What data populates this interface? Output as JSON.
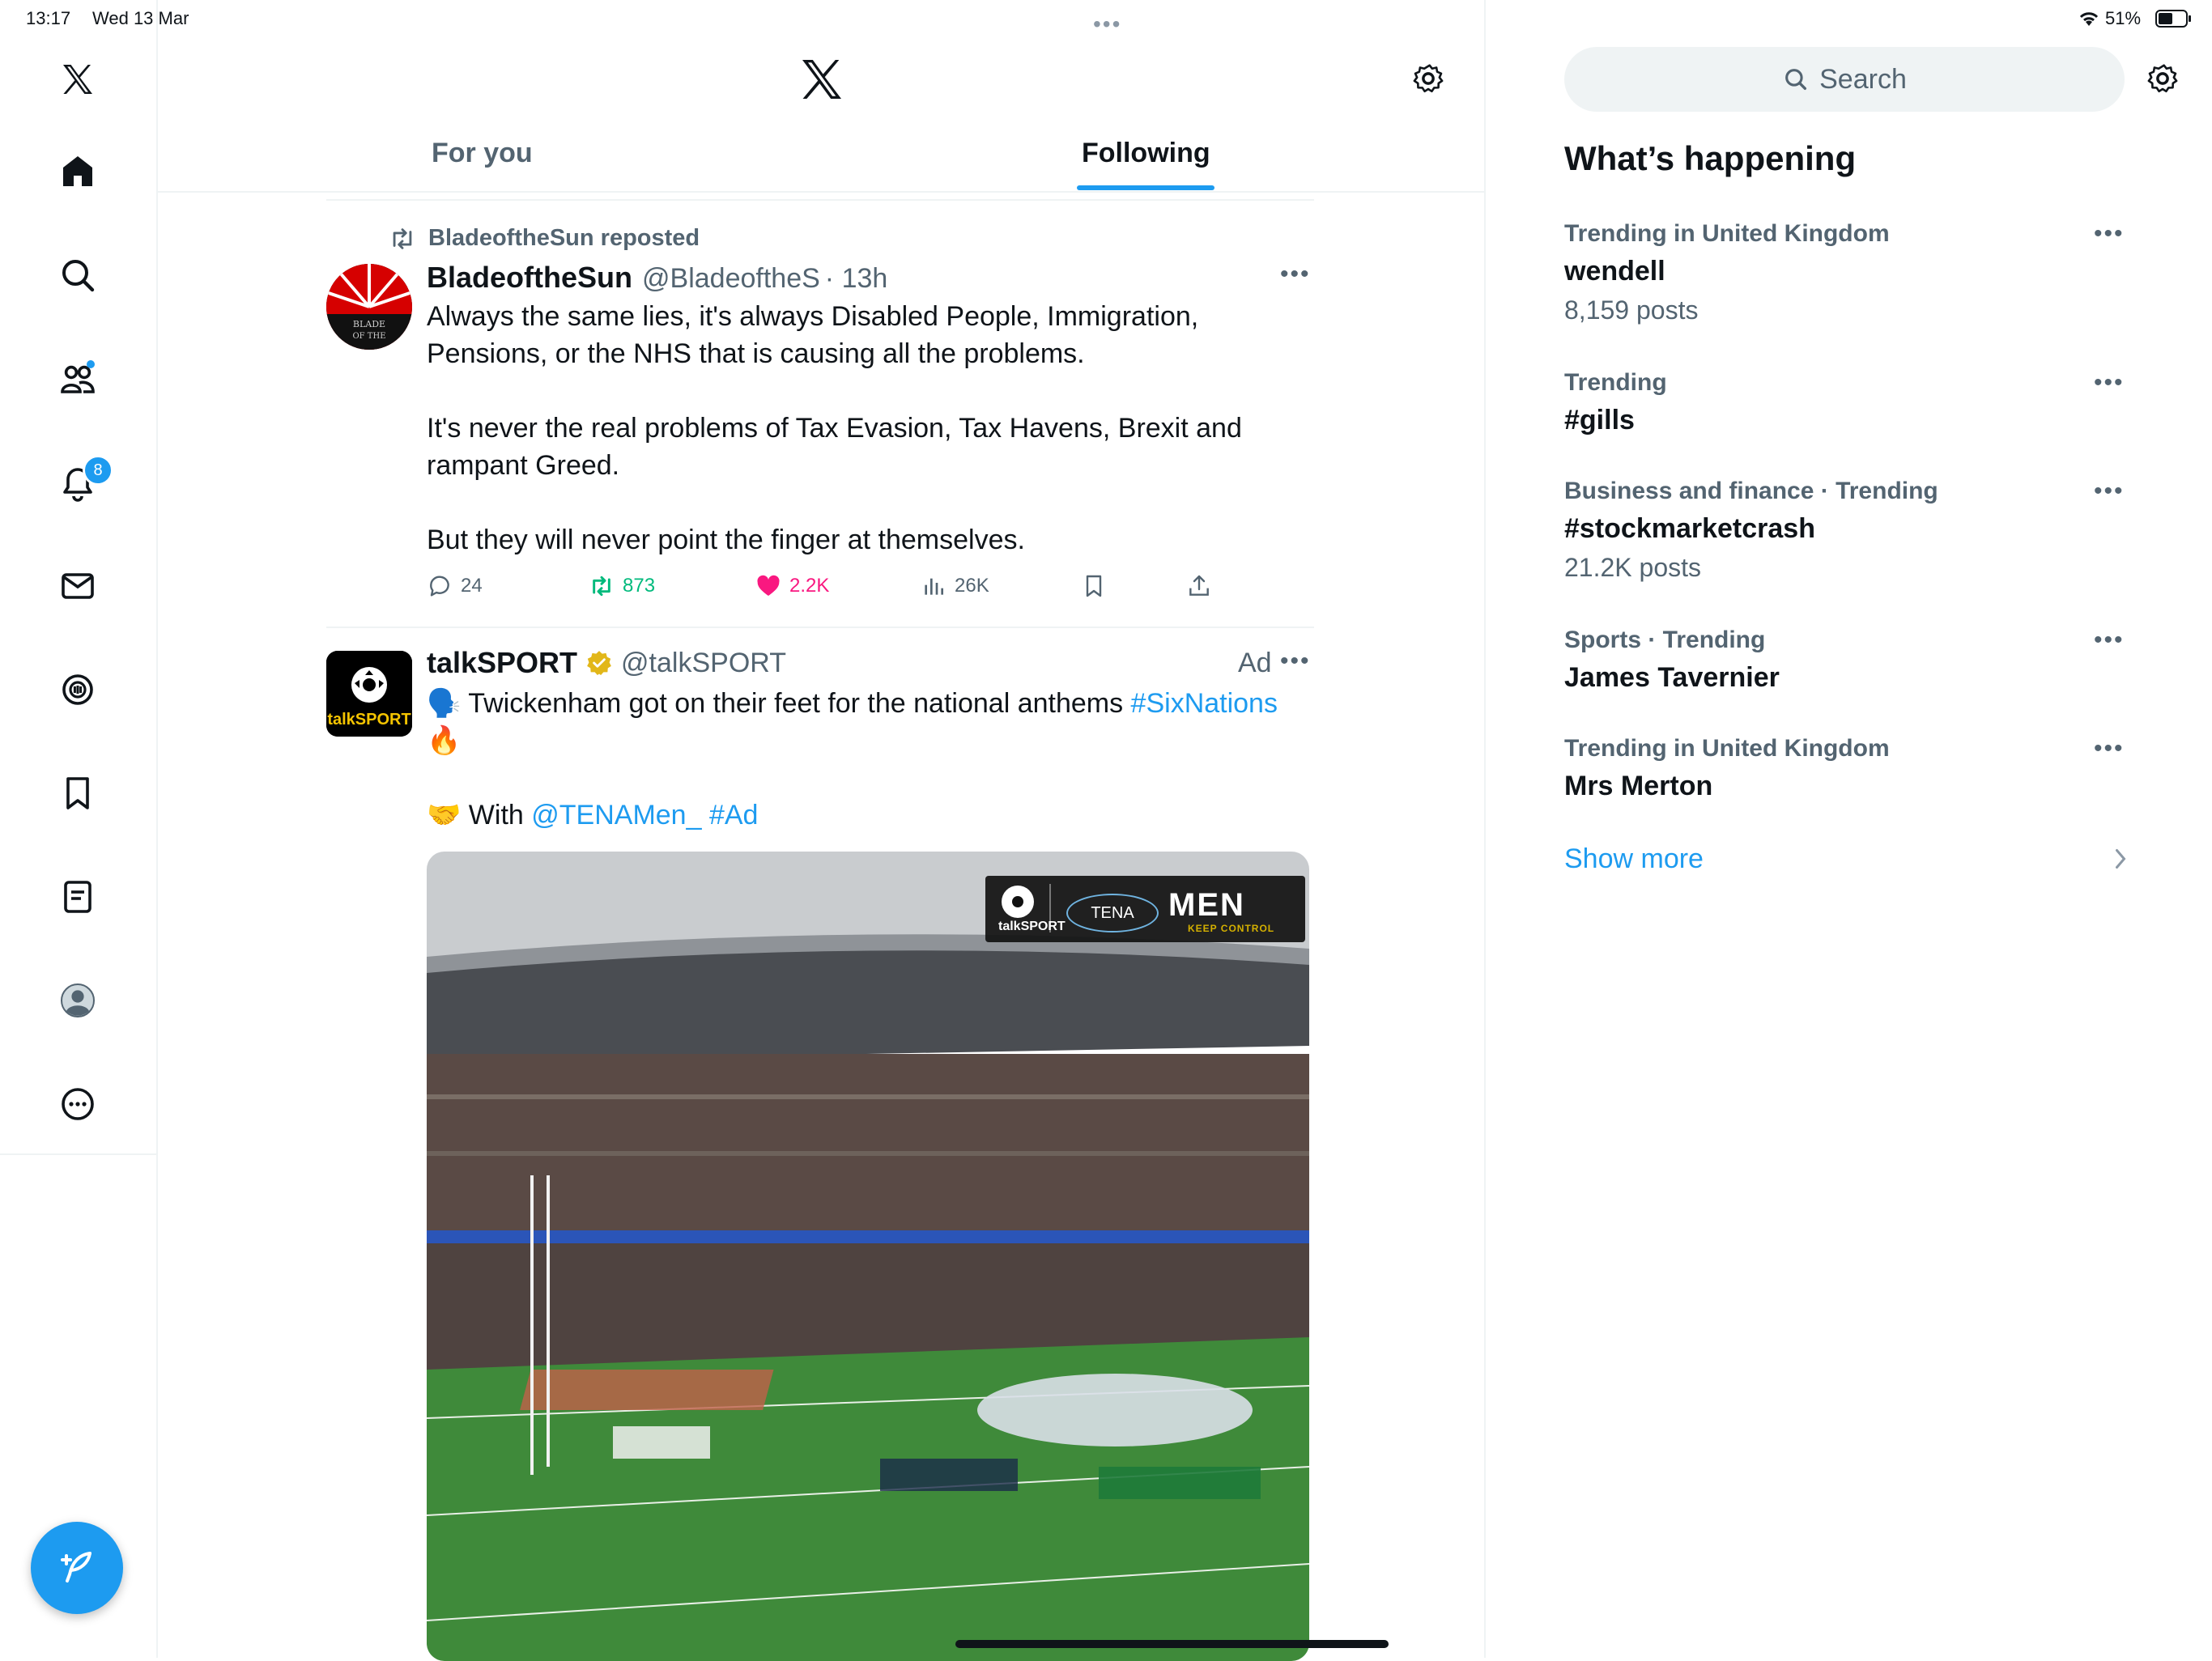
{
  "status_bar": {
    "time": "13:17",
    "date": "Wed 13 Mar",
    "battery": "51%"
  },
  "nav": {
    "notifications_badge": "8"
  },
  "header": {
    "tabs": [
      "For you",
      "Following"
    ],
    "active_tab": "Following"
  },
  "tweets": [
    {
      "repost_label": "BladeoftheSun reposted",
      "name": "BladeoftheSun",
      "handle": "@BladeoftheS",
      "time": "· 13h",
      "body": "Always the same lies, it's always Disabled People, Immigration,\nPensions, or the NHS that is causing all the problems.\n\nIt's never the real problems of Tax Evasion, Tax Havens, Brexit and\nrampant Greed.\n\nBut they will never point the finger at themselves.",
      "avatar_text": "BLADE OF THE",
      "replies": "24",
      "reposts": "873",
      "likes": "2.2K",
      "views": "26K"
    },
    {
      "name": "talkSPORT",
      "handle": "@talkSPORT",
      "ad_label": "Ad",
      "avatar_text": "talkSPORT",
      "line1_emoji": "🗣️",
      "line1_text": "Twickenham got on their feet for the national anthems ",
      "line1_hashtag": "#SixNations",
      "line2_emoji": "🔥",
      "line3_emoji": "🤝",
      "line3_text": "With ",
      "line3_mention": "@TENAMen_",
      "line3_hashtag": "#Ad",
      "media_overlay_brand1": "talkSPORT",
      "media_overlay_brand2": "TENA",
      "media_overlay_brand3": "MEN",
      "media_overlay_tagline": "KEEP CONTROL"
    }
  ],
  "sidebar": {
    "search_placeholder": "Search",
    "section_title": "What’s happening",
    "trends": [
      {
        "meta": "Trending in United Kingdom",
        "title": "wendell",
        "count": "8,159 posts"
      },
      {
        "meta": "Trending",
        "title": "#gills",
        "count": ""
      },
      {
        "meta": "Business and finance · Trending",
        "title": "#stockmarketcrash",
        "count": "21.2K posts"
      },
      {
        "meta": "Sports · Trending",
        "title": "James Tavernier",
        "count": ""
      },
      {
        "meta": "Trending in United Kingdom",
        "title": "Mrs Merton",
        "count": ""
      }
    ],
    "show_more": "Show more"
  },
  "colors": {
    "accent": "#1d9bf0",
    "like": "#f91880",
    "repost": "#00ba7c",
    "text_secondary": "#536471"
  },
  "icons": [
    "x-logo-icon",
    "home-icon",
    "search-icon",
    "communities-icon",
    "bell-icon",
    "mail-icon",
    "grok-icon",
    "bookmark-icon",
    "lists-icon",
    "profile-icon",
    "more-circle-icon",
    "compose-icon",
    "gear-icon",
    "reply-icon",
    "repost-icon",
    "heart-icon",
    "views-icon",
    "share-icon",
    "verified-badge-icon",
    "chevron-right-icon"
  ]
}
